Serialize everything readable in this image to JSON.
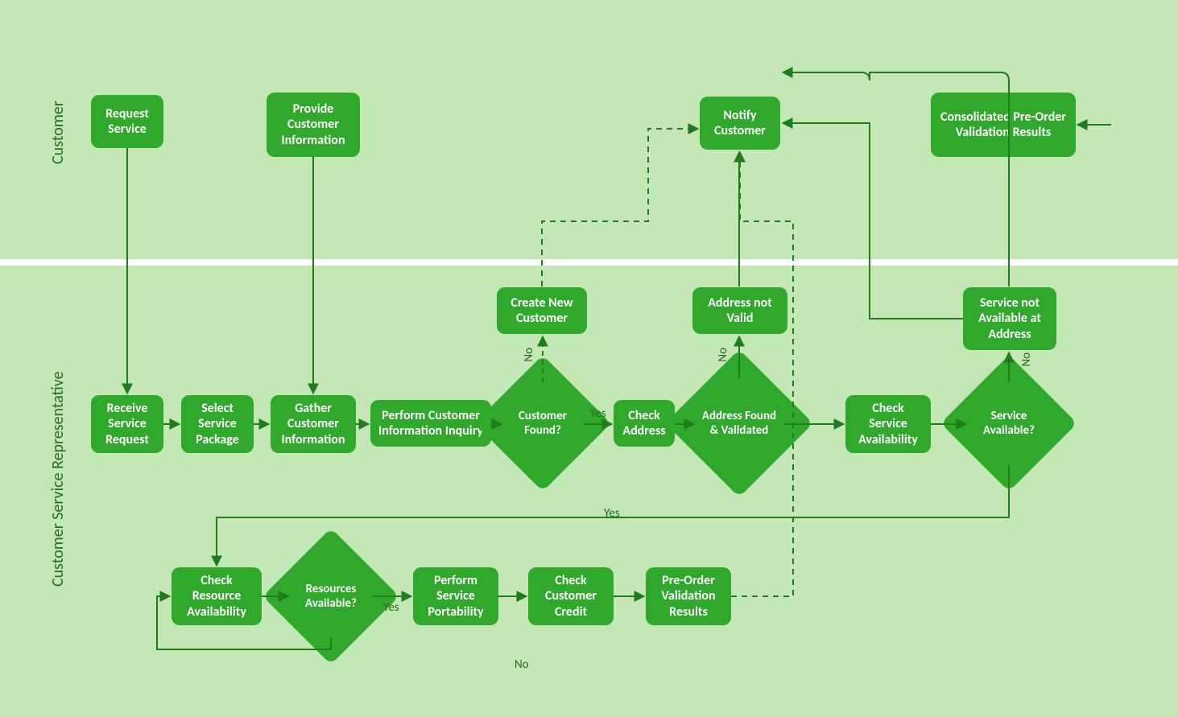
{
  "lanes": {
    "customer": "Customer",
    "csr": "Customer Service Representative"
  },
  "nodes": {
    "request_service": "Request Service",
    "provide_customer_info": "Provide Customer Information",
    "notify_customer": "Notify Customer",
    "consolidated_results": "Consolidated Pre-Order Validation Results",
    "receive_service_request": "Receive Service Request",
    "select_service_package": "Select Service Package",
    "gather_customer_info": "Gather Customer Information",
    "perform_customer_inquiry": "Perform Customer Information Inquiry",
    "create_new_customer": "Create New Customer",
    "check_address": "Check Address",
    "address_not_valid": "Address not Valid",
    "check_service_availability": "Check Service Availability",
    "service_not_available": "Service not Available at Address",
    "check_resource_availability": "Check Resource Availability",
    "perform_service_portability": "Perform Service Portability",
    "check_customer_credit": "Check Customer Credit",
    "preorder_validation_results": "Pre-Order Validation Results"
  },
  "decisions": {
    "customer_found": "Customer Found?",
    "address_found_validated": "Address Found & Validated",
    "service_available": "Service Available?",
    "resources_available": "Resources Available?"
  },
  "edge_labels": {
    "yes": "Yes",
    "no": "No"
  },
  "colors": {
    "bg": "#c3e8b5",
    "node": "#2fa82c",
    "stroke": "#1f7d1a"
  },
  "chart_data": {
    "type": "swimlane-flowchart",
    "lanes": [
      "Customer",
      "Customer Service Representative"
    ],
    "nodes": [
      {
        "id": "request_service",
        "lane": "Customer",
        "kind": "task",
        "label": "Request Service"
      },
      {
        "id": "provide_customer_info",
        "lane": "Customer",
        "kind": "task",
        "label": "Provide Customer Information"
      },
      {
        "id": "notify_customer",
        "lane": "Customer",
        "kind": "task",
        "label": "Notify Customer"
      },
      {
        "id": "consolidated_results",
        "lane": "Customer",
        "kind": "task",
        "label": "Consolidated Pre-Order Validation Results"
      },
      {
        "id": "receive_service_request",
        "lane": "Customer Service Representative",
        "kind": "task",
        "label": "Receive Service Request"
      },
      {
        "id": "select_service_package",
        "lane": "Customer Service Representative",
        "kind": "task",
        "label": "Select Service Package"
      },
      {
        "id": "gather_customer_info",
        "lane": "Customer Service Representative",
        "kind": "task",
        "label": "Gather Customer Information"
      },
      {
        "id": "perform_customer_inquiry",
        "lane": "Customer Service Representative",
        "kind": "task",
        "label": "Perform Customer Information Inquiry"
      },
      {
        "id": "customer_found",
        "lane": "Customer Service Representative",
        "kind": "decision",
        "label": "Customer Found?"
      },
      {
        "id": "create_new_customer",
        "lane": "Customer Service Representative",
        "kind": "task",
        "label": "Create New Customer"
      },
      {
        "id": "check_address",
        "lane": "Customer Service Representative",
        "kind": "task",
        "label": "Check Address"
      },
      {
        "id": "address_found_validated",
        "lane": "Customer Service Representative",
        "kind": "decision",
        "label": "Address Found & Validated"
      },
      {
        "id": "address_not_valid",
        "lane": "Customer Service Representative",
        "kind": "task",
        "label": "Address not Valid"
      },
      {
        "id": "check_service_availability",
        "lane": "Customer Service Representative",
        "kind": "task",
        "label": "Check Service Availability"
      },
      {
        "id": "service_available",
        "lane": "Customer Service Representative",
        "kind": "decision",
        "label": "Service Available?"
      },
      {
        "id": "service_not_available",
        "lane": "Customer Service Representative",
        "kind": "task",
        "label": "Service not Available at Address"
      },
      {
        "id": "check_resource_availability",
        "lane": "Customer Service Representative",
        "kind": "task",
        "label": "Check Resource Availability"
      },
      {
        "id": "resources_available",
        "lane": "Customer Service Representative",
        "kind": "decision",
        "label": "Resources Available?"
      },
      {
        "id": "perform_service_portability",
        "lane": "Customer Service Representative",
        "kind": "task",
        "label": "Perform Service Portability"
      },
      {
        "id": "check_customer_credit",
        "lane": "Customer Service Representative",
        "kind": "task",
        "label": "Check Customer Credit"
      },
      {
        "id": "preorder_validation_results",
        "lane": "Customer Service Representative",
        "kind": "task",
        "label": "Pre-Order Validation Results"
      }
    ],
    "edges": [
      {
        "from": "request_service",
        "to": "receive_service_request"
      },
      {
        "from": "receive_service_request",
        "to": "select_service_package"
      },
      {
        "from": "select_service_package",
        "to": "gather_customer_info"
      },
      {
        "from": "provide_customer_info",
        "to": "gather_customer_info"
      },
      {
        "from": "gather_customer_info",
        "to": "perform_customer_inquiry"
      },
      {
        "from": "perform_customer_inquiry",
        "to": "customer_found"
      },
      {
        "from": "customer_found",
        "to": "check_address",
        "label": "Yes"
      },
      {
        "from": "customer_found",
        "to": "create_new_customer",
        "label": "No",
        "style": "dashed"
      },
      {
        "from": "create_new_customer",
        "to": "notify_customer",
        "style": "dashed-route"
      },
      {
        "from": "check_address",
        "to": "address_found_validated"
      },
      {
        "from": "address_found_validated",
        "to": "check_service_availability"
      },
      {
        "from": "address_found_validated",
        "to": "address_not_valid",
        "label": "No"
      },
      {
        "from": "address_not_valid",
        "to": "notify_customer"
      },
      {
        "from": "check_service_availability",
        "to": "service_available"
      },
      {
        "from": "service_available",
        "to": "service_not_available",
        "label": "No"
      },
      {
        "from": "service_not_available",
        "to": "notify_customer"
      },
      {
        "from": "service_available",
        "to": "check_resource_availability",
        "label": "Yes"
      },
      {
        "from": "check_resource_availability",
        "to": "resources_available"
      },
      {
        "from": "resources_available",
        "to": "perform_service_portability",
        "label": "Yes"
      },
      {
        "from": "resources_available",
        "to": "check_resource_availability",
        "label": "No",
        "style": "loopback"
      },
      {
        "from": "perform_service_portability",
        "to": "check_customer_credit"
      },
      {
        "from": "check_customer_credit",
        "to": "preorder_validation_results"
      },
      {
        "from": "preorder_validation_results",
        "to": "notify_customer",
        "style": "dashed"
      },
      {
        "from": "preorder_validation_results",
        "to": "consolidated_results",
        "style": "dashed-route"
      },
      {
        "from": "notify_customer",
        "to": "consolidated_results",
        "style": "feedback"
      }
    ]
  }
}
